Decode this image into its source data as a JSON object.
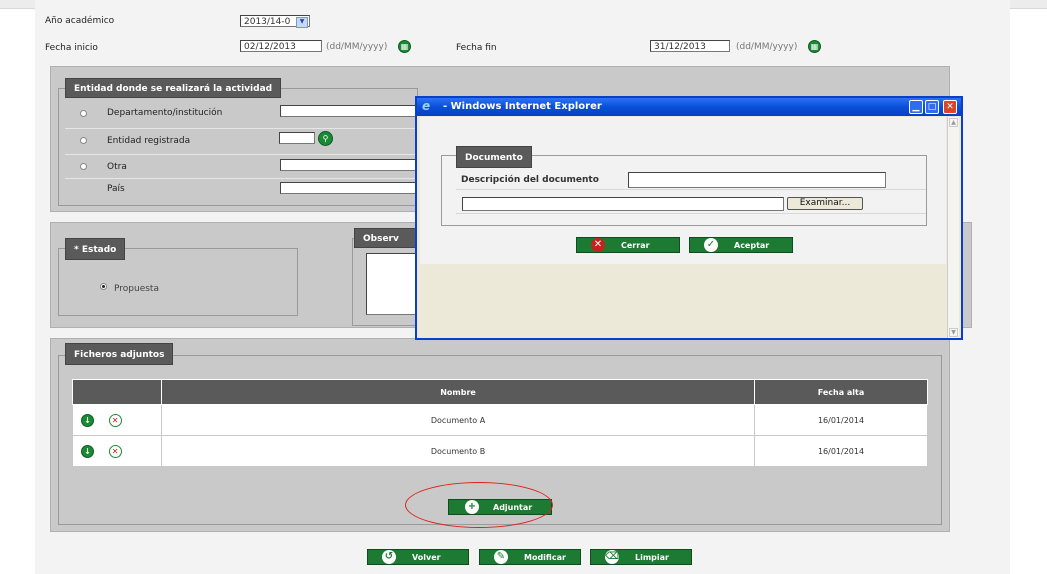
{
  "form": {
    "anio_label": "Año académico",
    "anio_value": "2013/14-0",
    "fecha_inicio_label": "Fecha inicio",
    "fecha_inicio_value": "02/12/2013",
    "fecha_fin_label": "Fecha fin",
    "fecha_fin_value": "31/12/2013",
    "date_hint": "(dd/MM/yyyy)"
  },
  "entidad": {
    "legend": "Entidad donde se realizará la actividad",
    "options": [
      "Departamento/institución",
      "Entidad registrada",
      "Otra"
    ],
    "pais_label": "País"
  },
  "estado": {
    "legend": "* Estado",
    "value": "Propuesta"
  },
  "observaciones": {
    "legend": "Observ"
  },
  "ficheros": {
    "legend": "Ficheros adjuntos",
    "columns": [
      "",
      "Nombre",
      "Fecha alta"
    ],
    "rows": [
      {
        "nombre": "Documento A",
        "fecha": "16/01/2014"
      },
      {
        "nombre": "Documento B",
        "fecha": "16/01/2014"
      }
    ],
    "adjuntar_label": "Adjuntar"
  },
  "actions": {
    "volver": "Volver",
    "modificar": "Modificar",
    "limpiar": "Limpiar"
  },
  "dialog": {
    "title": "- Windows Internet Explorer",
    "legend": "Documento",
    "descripcion_label": "Descripción del documento",
    "descripcion_value": "",
    "file_value": "",
    "examinar_label": "Examinar...",
    "cerrar_label": "Cerrar",
    "aceptar_label": "Aceptar"
  },
  "colors": {
    "accent_green": "#1d7a33",
    "legend_gray": "#5a5a5a",
    "annotation_red": "#d9231e",
    "titlebar_blue": "#0a4fd8"
  }
}
